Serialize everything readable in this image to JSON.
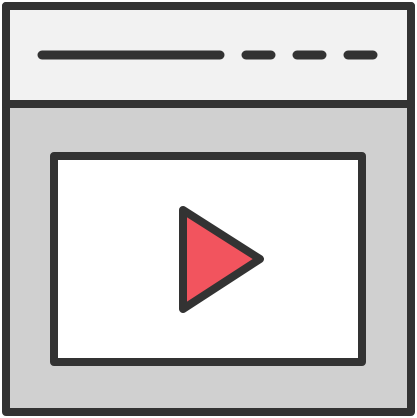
{
  "icon": {
    "name": "video-player-window-icon",
    "colors": {
      "outline": "#333333",
      "header_fill": "#f2f2f2",
      "body_fill": "#d0d0d0",
      "screen_fill": "#ffffff",
      "play_fill": "#f2545e"
    },
    "parts": {
      "title_bar": "title-bar",
      "window_controls": [
        "dash",
        "dash",
        "dash"
      ],
      "video_screen": "video-screen",
      "play_button": "play-icon"
    }
  }
}
